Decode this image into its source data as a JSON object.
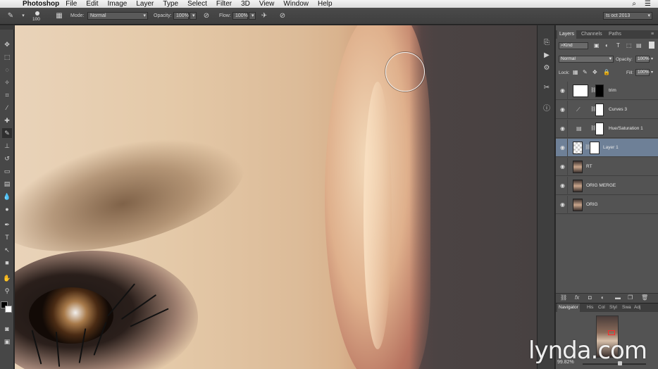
{
  "menubar": {
    "app_name": "Photoshop",
    "menus": [
      "File",
      "Edit",
      "Image",
      "Layer",
      "Type",
      "Select",
      "Filter",
      "3D",
      "View",
      "Window",
      "Help"
    ]
  },
  "options_bar": {
    "brush_size": "100",
    "mode_label": "Mode:",
    "mode_value": "Normal",
    "opacity_label": "Opacity:",
    "opacity_value": "100%",
    "flow_label": "Flow:",
    "flow_value": "100%",
    "workspace": "ts oct 2013"
  },
  "layers_panel": {
    "tabs": [
      "Layers",
      "Channels",
      "Paths"
    ],
    "kind_filter": "Kind",
    "blend_mode": "Normal",
    "opacity_label": "Opacity:",
    "opacity_value": "100%",
    "lock_label": "Lock:",
    "fill_label": "Fill:",
    "fill_value": "100%",
    "layers": [
      {
        "name": "trim",
        "thumb": "white",
        "has_mask": true,
        "mask": "black",
        "selected": false
      },
      {
        "name": "Curves 3",
        "thumb": "curves-adjustment",
        "has_mask": true,
        "mask": "white",
        "selected": false
      },
      {
        "name": "Hue/Saturation 1",
        "thumb": "hue-saturation-adjustment",
        "has_mask": true,
        "mask": "white",
        "selected": false
      },
      {
        "name": "Layer 1",
        "thumb": "transparent",
        "has_mask": true,
        "mask": "white",
        "selected": true
      },
      {
        "name": "RT",
        "thumb": "photo",
        "has_mask": false,
        "selected": false
      },
      {
        "name": "ORIG MERGE",
        "thumb": "photo",
        "has_mask": false,
        "selected": false
      },
      {
        "name": "ORIG",
        "thumb": "photo",
        "has_mask": false,
        "selected": false
      }
    ]
  },
  "navigator": {
    "tabs": [
      "Navigator",
      "His",
      "Col",
      "Styl",
      "Swa",
      "Adj"
    ],
    "zoom": "99.82%"
  },
  "watermark": "lynda.com",
  "colors": {
    "selected_layer": "#6e8097",
    "proxy_box": "#ff2a2a",
    "panel_bg": "#535353"
  }
}
